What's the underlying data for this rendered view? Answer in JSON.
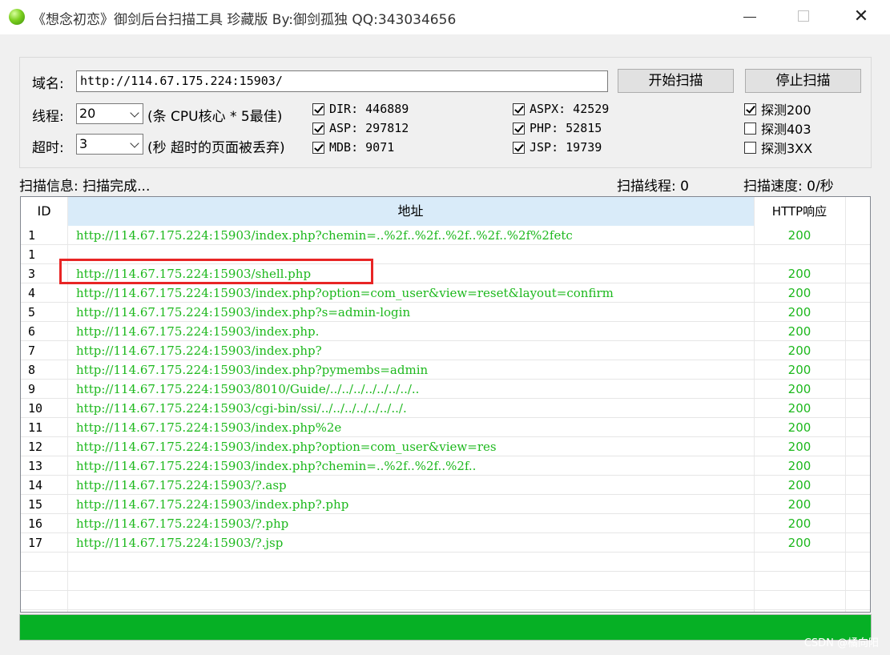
{
  "window": {
    "title": "《想念初恋》御剑后台扫描工具 珍藏版 By:御剑孤独 QQ:343034656",
    "close_glyph": "✕"
  },
  "form": {
    "domain_label": "域名:",
    "domain_value": "http://114.67.175.224:15903/",
    "thread_label": "线程:",
    "thread_value": "20",
    "thread_hint": "(条 CPU核心 * 5最佳)",
    "timeout_label": "超时:",
    "timeout_value": "3",
    "timeout_hint": "(秒 超时的页面被丢弃)",
    "start_button": "开始扫描",
    "stop_button": "停止扫描"
  },
  "dictionaries": [
    {
      "label": "DIR: 446889",
      "checked": true
    },
    {
      "label": "ASP: 297812",
      "checked": true
    },
    {
      "label": "MDB: 9071",
      "checked": true
    },
    {
      "label": "ASPX: 42529",
      "checked": true
    },
    {
      "label": "PHP: 52815",
      "checked": true
    },
    {
      "label": "JSP: 19739",
      "checked": true
    }
  ],
  "probes": [
    {
      "label": "探测200",
      "checked": true
    },
    {
      "label": "探测403",
      "checked": false
    },
    {
      "label": "探测3XX",
      "checked": false
    }
  ],
  "status": {
    "info": "扫描信息: 扫描完成...",
    "threads": "扫描线程: 0",
    "speed": "扫描速度: 0/秒"
  },
  "table": {
    "columns": [
      "ID",
      "地址",
      "HTTP响应"
    ],
    "rows": [
      {
        "id": "1",
        "address": "http://114.67.175.224:15903/index.php?chemin=..%2f..%2f..%2f..%2f..%2f%2fetc",
        "http": "200"
      },
      {
        "id": "1",
        "address": "",
        "http": ""
      },
      {
        "id": "3",
        "address": "http://114.67.175.224:15903/shell.php",
        "http": "200"
      },
      {
        "id": "4",
        "address": "http://114.67.175.224:15903/index.php?option=com_user&view=reset&layout=confirm",
        "http": "200"
      },
      {
        "id": "5",
        "address": "http://114.67.175.224:15903/index.php?s=admin-login",
        "http": "200"
      },
      {
        "id": "6",
        "address": "http://114.67.175.224:15903/index.php.",
        "http": "200"
      },
      {
        "id": "7",
        "address": "http://114.67.175.224:15903/index.php?",
        "http": "200"
      },
      {
        "id": "8",
        "address": "http://114.67.175.224:15903/index.php?pymembs=admin",
        "http": "200"
      },
      {
        "id": "9",
        "address": "http://114.67.175.224:15903/8010/Guide/../../../../../../../..",
        "http": "200"
      },
      {
        "id": "10",
        "address": "http://114.67.175.224:15903/cgi-bin/ssi/../../../../../../../.",
        "http": "200"
      },
      {
        "id": "11",
        "address": "http://114.67.175.224:15903/index.php%2e",
        "http": "200"
      },
      {
        "id": "12",
        "address": "http://114.67.175.224:15903/index.php?option=com_user&view=res",
        "http": "200"
      },
      {
        "id": "13",
        "address": "http://114.67.175.224:15903/index.php?chemin=..%2f..%2f..%2f..",
        "http": "200"
      },
      {
        "id": "14",
        "address": "http://114.67.175.224:15903/?.asp",
        "http": "200"
      },
      {
        "id": "15",
        "address": "http://114.67.175.224:15903/index.php?.php",
        "http": "200"
      },
      {
        "id": "16",
        "address": "http://114.67.175.224:15903/?.php",
        "http": "200"
      },
      {
        "id": "17",
        "address": "http://114.67.175.224:15903/?.jsp",
        "http": "200"
      }
    ]
  },
  "progress": {
    "fraction": 1.0,
    "color": "#06b025"
  },
  "watermark": "CSDN @橘向阳",
  "colors": {
    "result_text": "#1db81d",
    "header_highlight": "#d9ebf9",
    "annotation_box": "#e82525"
  }
}
